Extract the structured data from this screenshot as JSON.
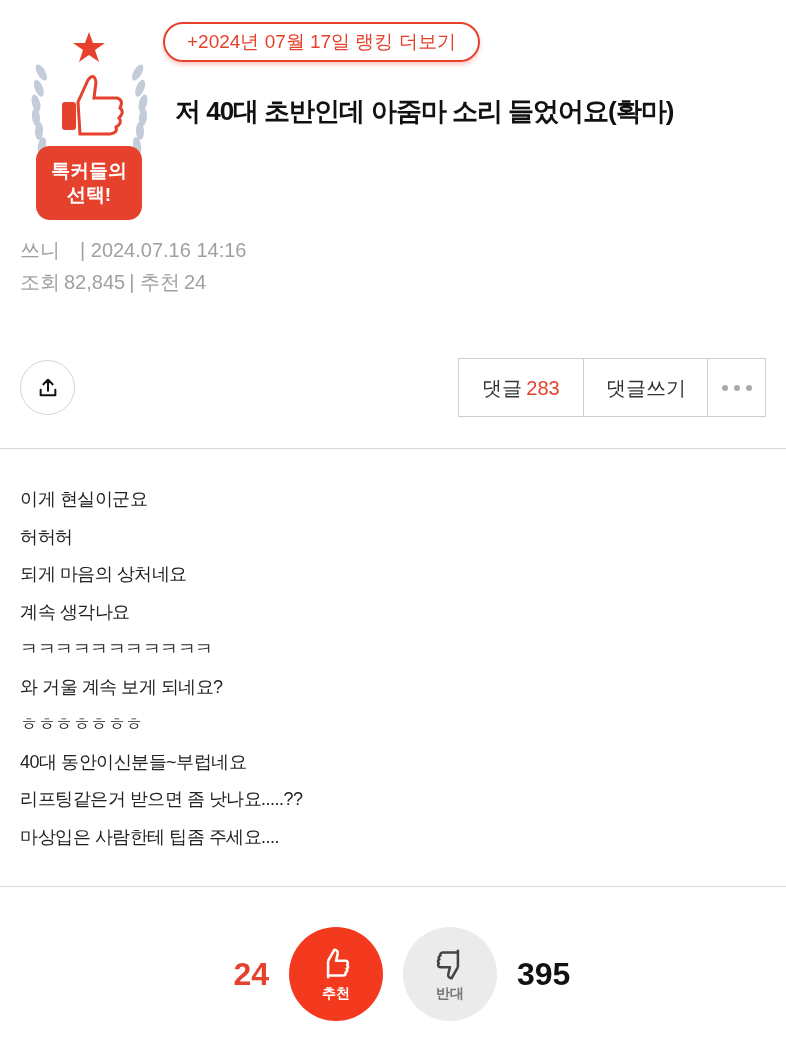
{
  "badge": {
    "line1": "톡커들의",
    "line2": "선택!"
  },
  "ranking_link": "+2024년 07월 17일 랭킹 더보기",
  "title": "저 40대 초반인데 아줌마 소리 들었어요(확마)",
  "meta": {
    "author": "쓰니",
    "datetime": "| 2024.07.16 14:16",
    "views_label": "조회",
    "views": "82,845",
    "likes_label": "| 추천",
    "likes": "24"
  },
  "actions": {
    "comments_label": "댓글",
    "comments_count": "283",
    "write_comment": "댓글쓰기"
  },
  "body": [
    "이게 현실이군요",
    "허허허",
    "되게 마음의 상처네요",
    "계속 생각나요",
    "ㅋㅋㅋㅋㅋㅋㅋㅋㅋㅋㅋ",
    "와 거울 계속 보게 되네요?",
    "ㅎㅎㅎㅎㅎㅎㅎ",
    "40대 동안이신분들~부럽네요",
    "리프팅같은거 받으면 좀 낫나요.....??",
    "마상입은 사람한테 팁좀 주세요...."
  ],
  "votes": {
    "up_count": "24",
    "up_label": "추천",
    "down_label": "반대",
    "down_count": "395"
  }
}
